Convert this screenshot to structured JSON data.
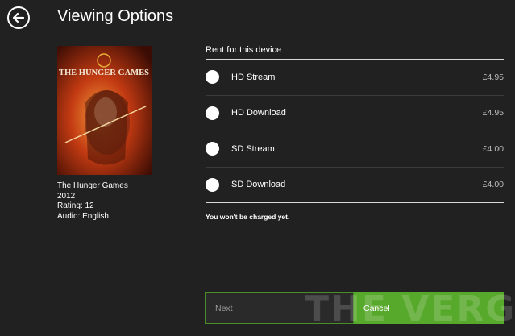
{
  "header": {
    "title": "Viewing Options",
    "back_icon": "back-arrow-icon"
  },
  "movie": {
    "poster_text": "THE HUNGER GAMES",
    "title": "The Hunger Games",
    "year": "2012",
    "rating": "Rating: 12",
    "audio": "Audio: English"
  },
  "rent": {
    "heading": "Rent for this device",
    "options": [
      {
        "label": "HD Stream",
        "price": "£4.95"
      },
      {
        "label": "HD Download",
        "price": "£4.95"
      },
      {
        "label": "SD Stream",
        "price": "£4.00"
      },
      {
        "label": "SD Download",
        "price": "£4.00"
      }
    ],
    "note": "You won't be charged yet."
  },
  "buttons": {
    "next_label": "Next",
    "cancel_label": "Cancel"
  },
  "watermark": "THE VERGE",
  "colors": {
    "background": "#212121",
    "accent": "#57a92b"
  }
}
